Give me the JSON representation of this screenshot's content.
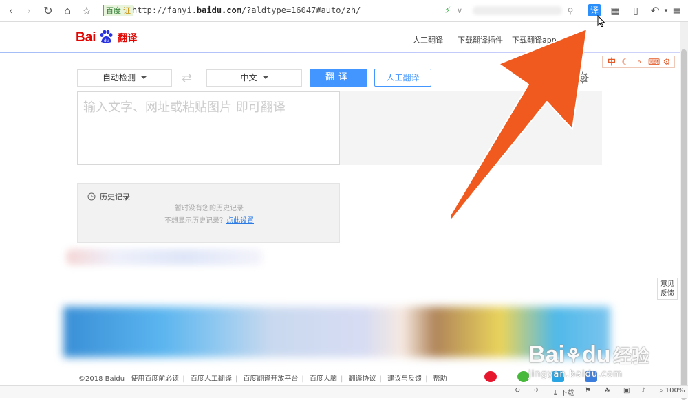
{
  "browser": {
    "badge_label": "百度",
    "badge_verified": "证",
    "url_prefix": "http://fanyi.",
    "url_domain": "baidu.com",
    "url_suffix": "/?aldtype=16047#auto/zh/",
    "translate_button": "译",
    "status_download": "下载",
    "zoom": "100%"
  },
  "header": {
    "logo_text": "Bai",
    "logo_du": "du",
    "logo_product": "翻译",
    "nav": [
      "人工翻译",
      "下载翻译插件",
      "下载翻译app"
    ],
    "tools": [
      "中",
      "☾",
      "∘",
      "⌨",
      "⚙"
    ]
  },
  "translate": {
    "source_lang": "自动检测",
    "target_lang": "中文",
    "translate_label": "翻译",
    "human_label": "人工翻译",
    "input_placeholder": "输入文字、网址或粘贴图片 即可翻译"
  },
  "history": {
    "title": "历史记录",
    "empty_text": "暂时没有您的历史记录",
    "disable_prefix": "不想显示历史记录？",
    "disable_link": "点此设置"
  },
  "feedback": {
    "line1": "意见",
    "line2": "反馈"
  },
  "footer": {
    "items": [
      "©2018 Baidu",
      "使用百度前必读",
      "百度人工翻译",
      "百度翻译开放平台",
      "百度大脑",
      "翻译协议",
      "建议与反馈",
      "帮助"
    ]
  },
  "watermark": {
    "main": "Bai",
    "du": "du",
    "cn": "经验",
    "url": "jingyan.baidu.com"
  },
  "colors": {
    "arrow": "#f05a1e",
    "brand_red": "#e10602",
    "primary_blue": "#4395ff"
  }
}
